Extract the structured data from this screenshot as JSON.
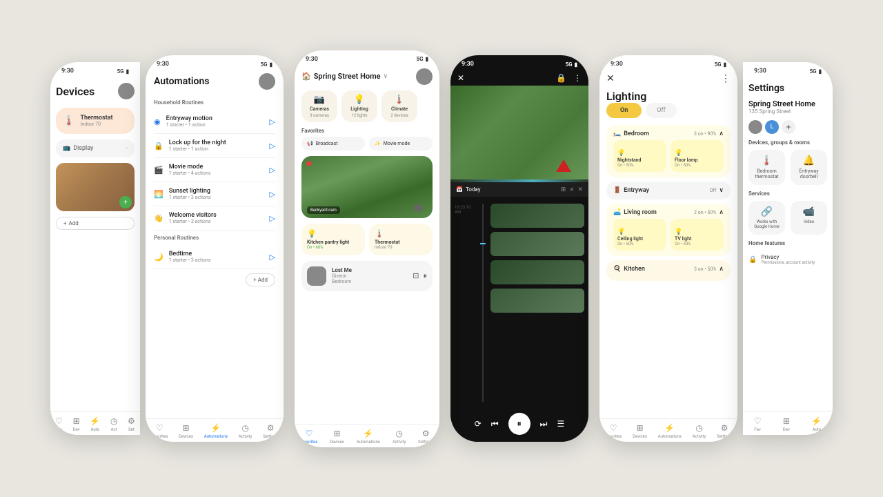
{
  "phones": [
    {
      "id": "phone1",
      "type": "partial-left",
      "screen": "devices",
      "statusBar": {
        "time": "9:30",
        "signal": "5G",
        "battery": "▮▮▮"
      },
      "title": "Devices",
      "devices": [
        {
          "name": "Thermostat",
          "sub": "Indoor 70",
          "icon": "🌡️",
          "color": "#fde8d8"
        },
        {
          "name": "Display",
          "icon": "📺"
        }
      ],
      "nav": [
        {
          "label": "Favorites",
          "icon": "♡",
          "active": false
        },
        {
          "label": "Devices",
          "icon": "⊞",
          "active": false
        },
        {
          "label": "Automations",
          "icon": "⚡",
          "active": false
        },
        {
          "label": "Activity",
          "icon": "◷",
          "active": false
        },
        {
          "label": "Settings",
          "icon": "⚙",
          "active": false
        }
      ]
    },
    {
      "id": "phone2",
      "type": "full",
      "screen": "automations",
      "statusBar": {
        "time": "9:30",
        "signal": "5G",
        "battery": "▮▮▮"
      },
      "title": "Automations",
      "sections": [
        {
          "title": "Household Routines",
          "routines": [
            {
              "name": "Entryway motion",
              "sub": "1 starter • 1 action",
              "icon": "◉"
            },
            {
              "name": "Lock up for the night",
              "sub": "1 starter • 1 action",
              "icon": "🔒"
            },
            {
              "name": "Movie mode",
              "sub": "1 starter • 4 actions",
              "icon": "🎬"
            },
            {
              "name": "Sunset lighting",
              "sub": "1 starter • 3 actions",
              "icon": "🌅"
            },
            {
              "name": "Welcome visitors",
              "sub": "1 starter • 2 actions",
              "icon": "👋"
            }
          ]
        },
        {
          "title": "Personal Routines",
          "routines": [
            {
              "name": "Bedtime",
              "sub": "1 starter • 3 actions",
              "icon": "🌙"
            }
          ]
        }
      ],
      "addBtn": "+ Add",
      "nav": [
        {
          "label": "Favorites",
          "icon": "♡",
          "active": false
        },
        {
          "label": "Devices",
          "icon": "⊞",
          "active": false
        },
        {
          "label": "Automations",
          "icon": "⚡",
          "active": true
        },
        {
          "label": "Activity",
          "icon": "◷",
          "active": false
        },
        {
          "label": "Settings",
          "icon": "⚙",
          "active": false
        }
      ]
    },
    {
      "id": "phone3",
      "type": "full-center",
      "screen": "home",
      "statusBar": {
        "time": "9:30",
        "signal": "5G",
        "battery": "▮▮▮"
      },
      "homeTitle": "Spring Street Home",
      "categories": [
        {
          "name": "Cameras",
          "sub": "3 cameras",
          "icon": "📷"
        },
        {
          "name": "Lighting",
          "sub": "12 lights",
          "icon": "💡"
        },
        {
          "name": "Climate",
          "sub": "2 devices",
          "icon": "🌡️"
        }
      ],
      "favoritesLabel": "Favorites",
      "favorites": [
        {
          "label": "Broadcast",
          "icon": "📢"
        },
        {
          "label": "Movie mode",
          "icon": "✨"
        }
      ],
      "cameraLabel": "Backyard cam",
      "quickCards": [
        {
          "name": "Kitchen pantry light",
          "status": "On • 60%",
          "icon": "💡"
        },
        {
          "name": "Thermostat",
          "sub": "Indoor 70",
          "icon": "🌡️"
        }
      ],
      "musicCard": {
        "song": "Lost Me",
        "artist": "Giveon",
        "room": "Bedroom"
      },
      "nav": [
        {
          "label": "Favorites",
          "icon": "♡",
          "active": true
        },
        {
          "label": "Devices",
          "icon": "⊞",
          "active": false
        },
        {
          "label": "Automations",
          "icon": "⚡",
          "active": false
        },
        {
          "label": "Activity",
          "icon": "◷",
          "active": false
        },
        {
          "label": "Settings",
          "icon": "⚙",
          "active": false
        }
      ]
    },
    {
      "id": "phone4",
      "type": "full",
      "screen": "camera-dark",
      "statusBar": {
        "time": "9:30",
        "signal": "5G",
        "battery": "▮▮▮"
      },
      "todayLabel": "Today",
      "timeLabel": "10:23:10 AM",
      "controls": [
        "shuffle",
        "prev",
        "pause",
        "next",
        "menu"
      ]
    },
    {
      "id": "phone5",
      "type": "full",
      "screen": "lighting",
      "statusBar": {
        "time": "9:30",
        "signal": "5G",
        "battery": "▮▮▮"
      },
      "title": "Lighting",
      "onLabel": "On",
      "offLabel": "Off",
      "groups": [
        {
          "name": "Bedroom",
          "status": "3 on • 90%",
          "icon": "🛏️",
          "subLights": [
            {
              "name": "Nightstand",
              "status": "On • 50%"
            },
            {
              "name": "Floor lamp",
              "status": "On • 50%"
            }
          ]
        },
        {
          "name": "Entryway",
          "status": "Off",
          "icon": "🚪"
        },
        {
          "name": "Living room",
          "status": "2 on • 50%",
          "icon": "🛋️",
          "subLights": [
            {
              "name": "Ceiling light",
              "status": "On • 50%"
            },
            {
              "name": "TV light",
              "status": "On • 50%"
            }
          ]
        },
        {
          "name": "Kitchen",
          "status": "3 on • 50%",
          "icon": "🍳"
        }
      ],
      "nav": [
        {
          "label": "Favorites",
          "icon": "♡",
          "active": false
        },
        {
          "label": "Devices",
          "icon": "⊞",
          "active": false
        },
        {
          "label": "Automations",
          "icon": "⚡",
          "active": false
        },
        {
          "label": "Activity",
          "icon": "◷",
          "active": false
        },
        {
          "label": "Settings",
          "icon": "⚙",
          "active": false
        }
      ]
    },
    {
      "id": "phone6",
      "type": "partial-right",
      "screen": "settings",
      "statusBar": {
        "time": "9:30",
        "signal": "5G",
        "battery": "▮▮▮"
      },
      "title": "Settings",
      "homeName": "Spring Street Home",
      "address": "135 Spring Street",
      "devicesGroupsLabel": "Devices, groups & rooms",
      "devices": [
        {
          "name": "Bedroom thermostat",
          "icon": "🌡️"
        },
        {
          "name": "Entryway doorbell",
          "icon": "🔔"
        }
      ],
      "servicesLabel": "Services",
      "services": [
        {
          "name": "Works with Google Home",
          "icon": "🔗"
        },
        {
          "name": "Video",
          "icon": "📹"
        }
      ],
      "homeFeaturesLabel": "Home features",
      "features": [
        {
          "name": "Privacy",
          "sub": "Permissions, account activity",
          "icon": "🔒"
        }
      ],
      "nav": [
        {
          "label": "Favorites",
          "icon": "♡",
          "active": false
        },
        {
          "label": "Devices",
          "icon": "⊞",
          "active": false
        },
        {
          "label": "Automations",
          "icon": "⚡",
          "active": false
        }
      ]
    }
  ]
}
